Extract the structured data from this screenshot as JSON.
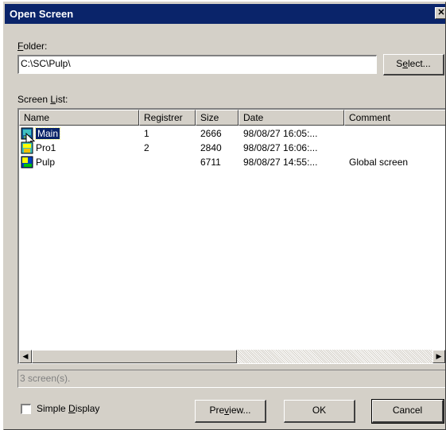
{
  "window": {
    "title": "Open Screen",
    "close_glyph": "✕"
  },
  "folder": {
    "label_accel": "F",
    "label_rest": "older:",
    "value": "C:\\SC\\Pulp\\",
    "select_btn_pre": "S",
    "select_btn_accel": "e",
    "select_btn_post": "lect..."
  },
  "screen_list": {
    "label_pre": "Screen ",
    "label_accel": "L",
    "label_post": "ist:",
    "columns": [
      "Name",
      "Registrer",
      "Size",
      "Date",
      "Comment"
    ],
    "rows": [
      {
        "name": "Main",
        "registrer": "1",
        "size": "2666",
        "date": "98/08/27 16:05:...",
        "comment": "",
        "icon": "screen-icon-main",
        "selected": true
      },
      {
        "name": "Pro1",
        "registrer": "2",
        "size": "2840",
        "date": "98/08/27 16:06:...",
        "comment": "",
        "icon": "screen-icon-pro1",
        "selected": false
      },
      {
        "name": "Pulp",
        "registrer": "",
        "size": "6711",
        "date": "98/08/27 14:55:...",
        "comment": "Global screen",
        "icon": "global-screen-icon",
        "selected": false
      }
    ]
  },
  "status": {
    "text": "3 screen(s)."
  },
  "options": {
    "simple_display_pre": "Simple ",
    "simple_display_accel": "D",
    "simple_display_post": "isplay",
    "simple_display_checked": false
  },
  "buttons": {
    "preview_pre": "Pre",
    "preview_accel": "v",
    "preview_post": "iew...",
    "ok": "OK",
    "cancel": "Cancel"
  },
  "colors": {
    "titlebar": "#0a246a",
    "face": "#d4d0c8",
    "selection": "#0a246a"
  }
}
